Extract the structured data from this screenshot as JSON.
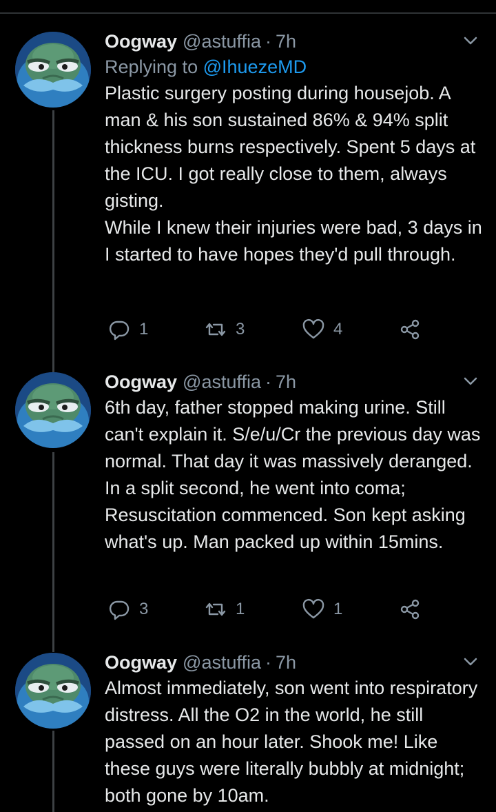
{
  "tweets": [
    {
      "name": "Oogway",
      "handle": "@astuffia",
      "dot": "·",
      "time": "7h",
      "replying_prefix": "Replying to",
      "replying_to": "@IhuezeMD",
      "text": "Plastic surgery posting during housejob. A man & his son sustained 86% & 94% split thickness burns respectively. Spent 5 days at the ICU. I got really close to them, always gisting.\nWhile I knew their injuries were bad, 3 days in I started to have hopes they'd pull through.",
      "replies": "1",
      "retweets": "3",
      "likes": "4"
    },
    {
      "name": "Oogway",
      "handle": "@astuffia",
      "dot": "·",
      "time": "7h",
      "text": "6th day, father stopped making urine. Still can't explain it. S/e/u/Cr the previous day was normal. That day it was massively deranged. In a split second, he went into coma; Resuscitation commenced. Son kept asking what's up. Man packed up within 15mins.",
      "replies": "3",
      "retweets": "1",
      "likes": "1"
    },
    {
      "name": "Oogway",
      "handle": "@astuffia",
      "dot": "·",
      "time": "7h",
      "text": "Almost immediately, son went into respiratory distress. All the O2 in the world, he still passed on an hour later. Shook me! Like these guys were literally bubbly at midnight; both gone by 10am."
    }
  ],
  "icons": {
    "reply": "reply-icon",
    "retweet": "retweet-icon",
    "like": "like-icon",
    "share": "share-icon",
    "more": "chevron-down-icon"
  },
  "colors": {
    "background": "#000000",
    "text": "#e7e9ea",
    "secondary": "#8b98a5",
    "link": "#1d9bf0",
    "thread_line": "#3d4144"
  }
}
